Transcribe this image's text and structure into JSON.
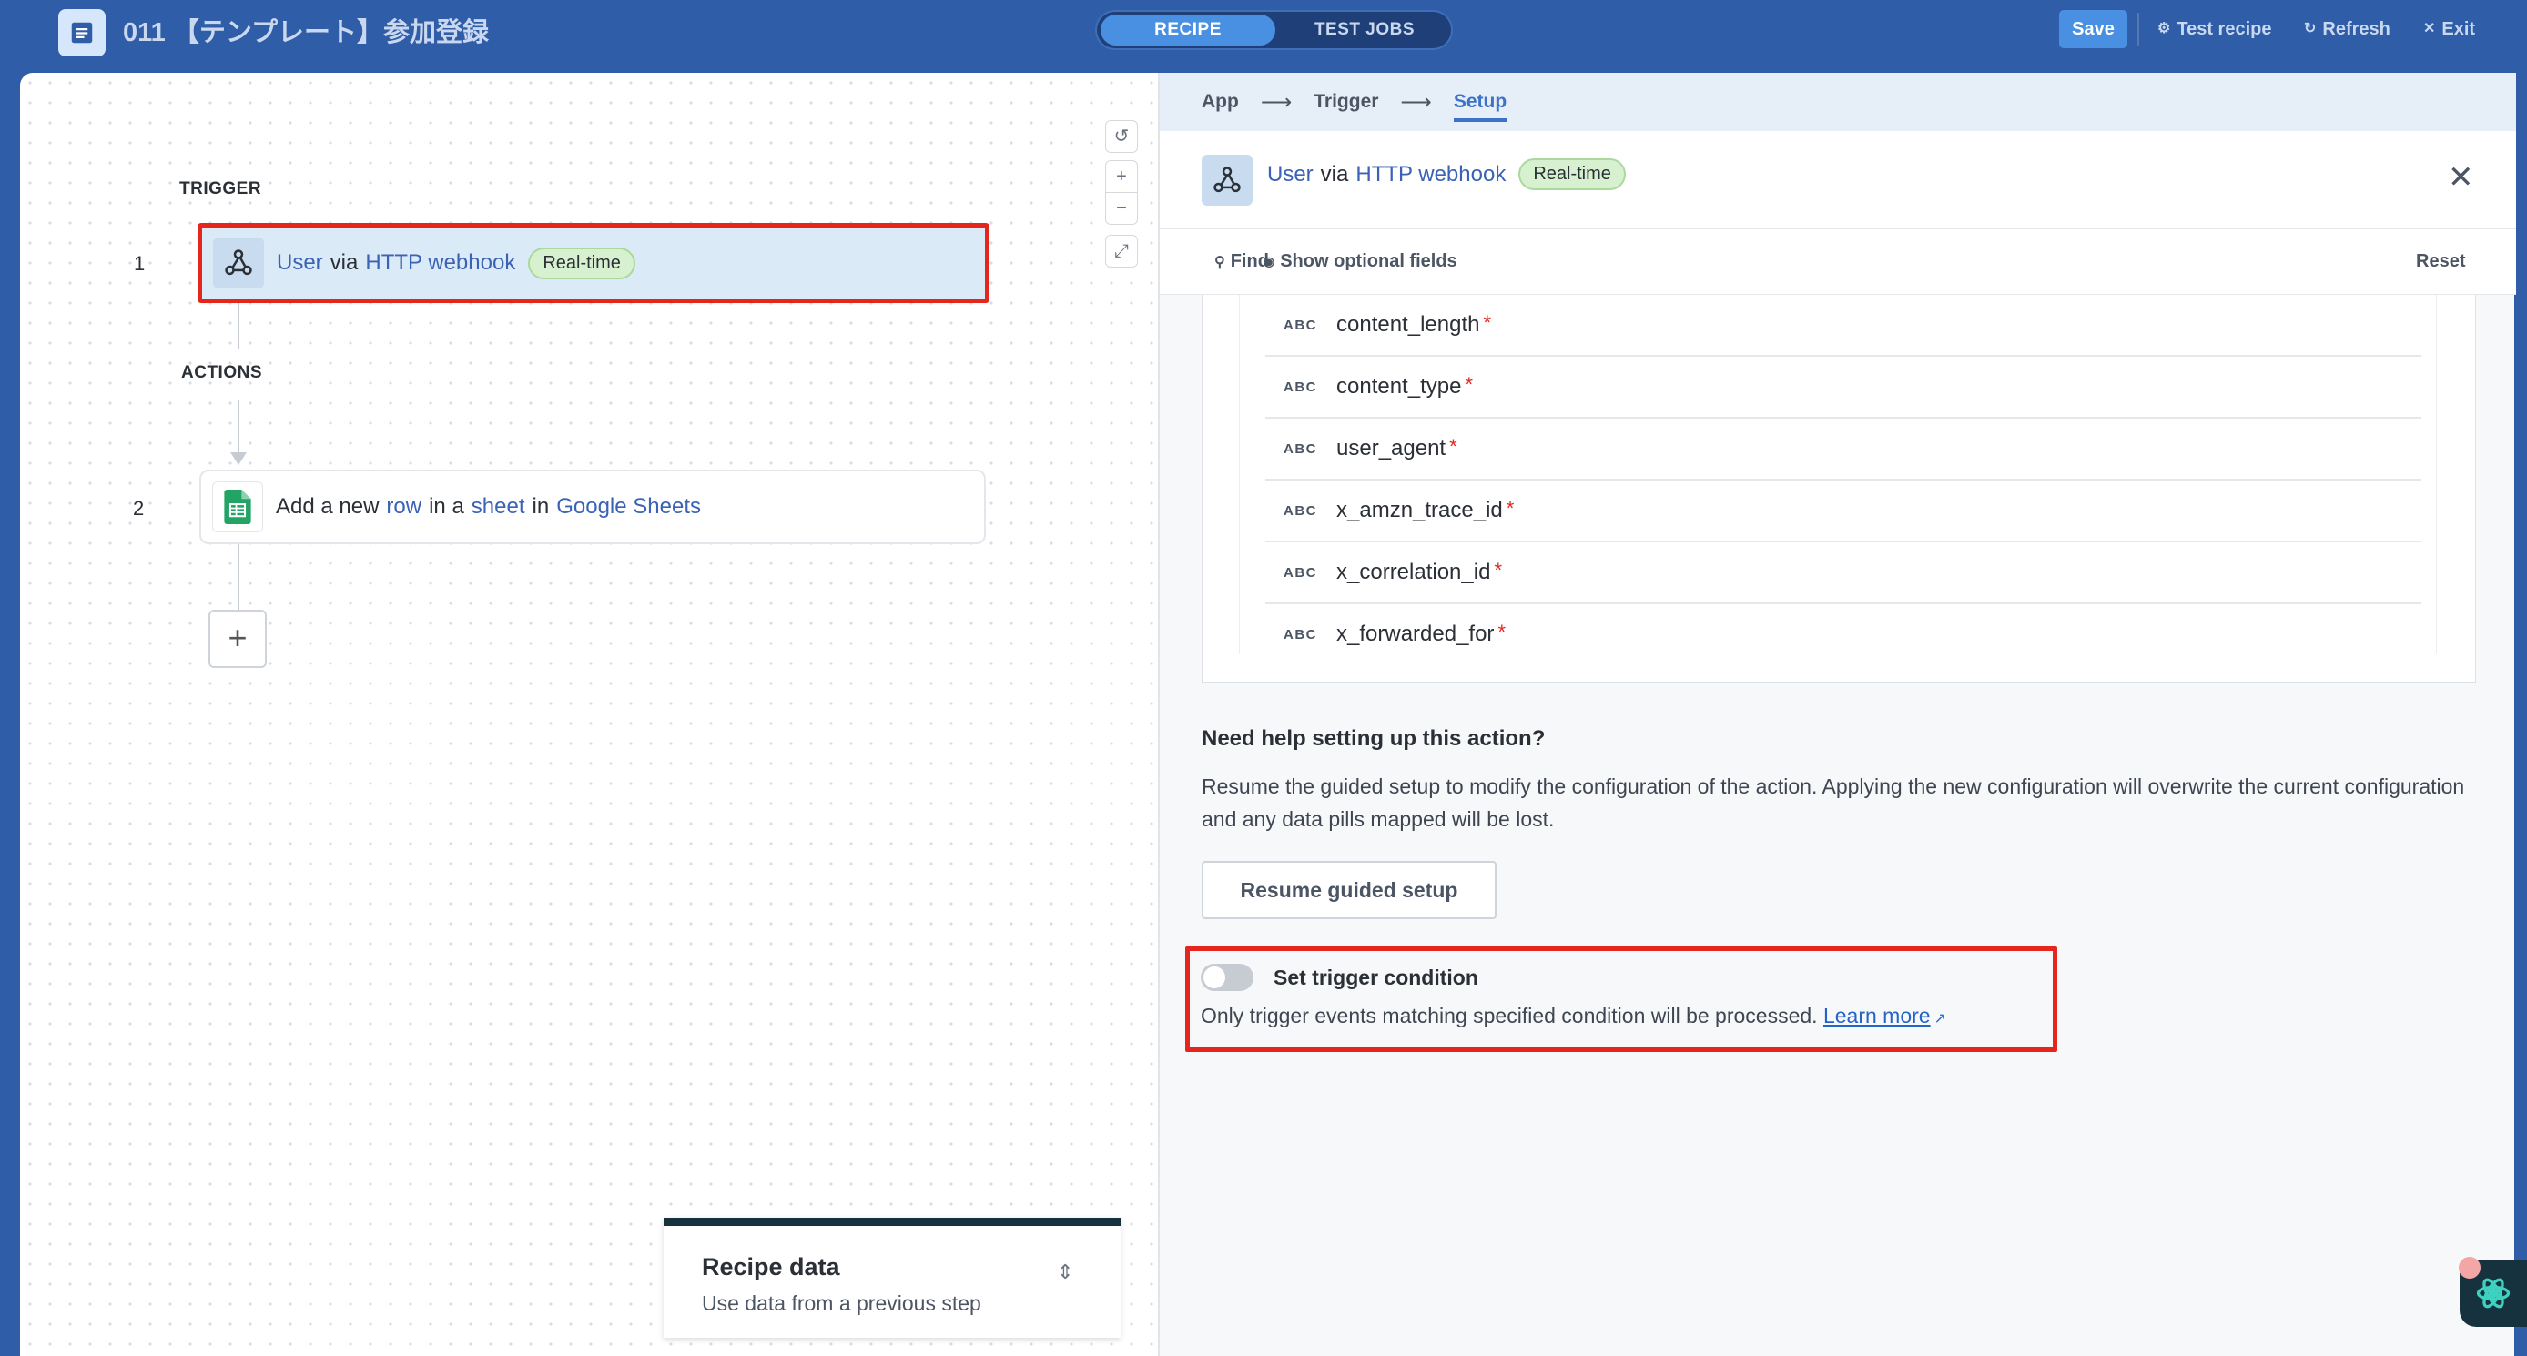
{
  "topbar": {
    "recipe_title": "011 【テンプレート】参加登録",
    "tabs": [
      "RECIPE",
      "TEST JOBS"
    ],
    "save_label": "Save",
    "test_recipe_label": "Test recipe",
    "refresh_label": "Refresh",
    "exit_label": "Exit"
  },
  "canvas": {
    "trigger_label": "TRIGGER",
    "actions_label": "ACTIONS",
    "steps": [
      {
        "num": "1",
        "parts": [
          "User",
          "via",
          "HTTP webhook"
        ],
        "badge": "Real-time"
      },
      {
        "num": "2",
        "parts": [
          "Add a new",
          "row",
          "in a",
          "sheet",
          "in",
          "Google Sheets"
        ]
      }
    ],
    "add_step_label": "+",
    "recipe_data": {
      "title": "Recipe data",
      "subtitle": "Use data from a previous step"
    }
  },
  "panel": {
    "breadcrumbs": [
      "App",
      "Trigger",
      "Setup"
    ],
    "header": {
      "parts": [
        "User",
        "via",
        "HTTP webhook"
      ],
      "badge": "Real-time"
    },
    "find_label": "Find",
    "optional_label": "Show optional fields",
    "reset_label": "Reset",
    "field_type": "ABC",
    "fields": [
      "content_length",
      "content_type",
      "user_agent",
      "x_amzn_trace_id",
      "x_correlation_id",
      "x_forwarded_for"
    ],
    "help_title": "Need help setting up this action?",
    "help_text": "Resume the guided setup to modify the configuration of the action. Applying the new configuration will overwrite the current configuration and any data pills mapped will be lost.",
    "resume_label": "Resume guided setup",
    "condition": {
      "title": "Set trigger condition",
      "text": "Only trigger events matching specified condition will be processed.",
      "link": "Learn more",
      "enabled": false
    }
  },
  "colors": {
    "accent": "#4a90e2",
    "topbar": "#2f5da8",
    "highlight": "#e5261d"
  }
}
